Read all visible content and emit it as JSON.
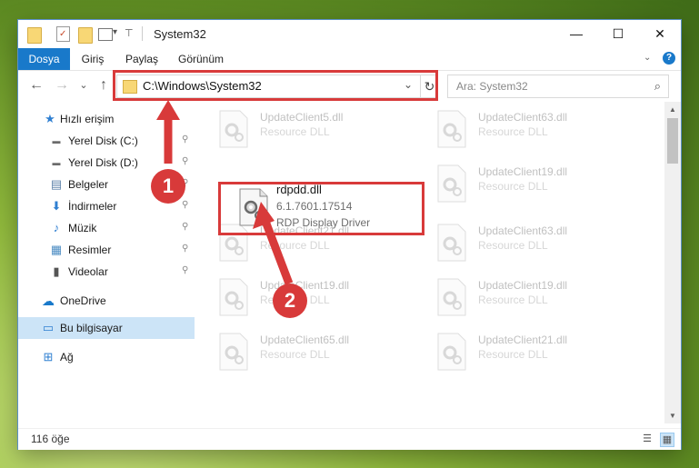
{
  "window": {
    "title": "System32",
    "controls": {
      "minimize": "—",
      "maximize": "☐",
      "close": "✕"
    }
  },
  "ribbon": {
    "tabs": [
      {
        "label": "Dosya",
        "active": true
      },
      {
        "label": "Giriş",
        "active": false
      },
      {
        "label": "Paylaş",
        "active": false
      },
      {
        "label": "Görünüm",
        "active": false
      }
    ]
  },
  "nav": {
    "back": "←",
    "forward": "→",
    "recent": "⌄",
    "up": "↑",
    "address": "C:\\Windows\\System32",
    "address_dropdown": "⌄",
    "refresh": "↻",
    "search_placeholder": "Ara: System32",
    "search_icon": "⌕"
  },
  "sidebar": {
    "items": [
      {
        "label": "Hızlı erişim",
        "icon": "★",
        "icon_name": "star-icon"
      },
      {
        "label": "Yerel Disk (C:)",
        "icon": "▬",
        "icon_name": "drive-icon"
      },
      {
        "label": "Yerel Disk (D:)",
        "icon": "▬",
        "icon_name": "drive-icon"
      },
      {
        "label": "Belgeler",
        "icon": "▤",
        "icon_name": "documents-icon"
      },
      {
        "label": "İndirmeler",
        "icon": "⬇",
        "icon_name": "downloads-icon"
      },
      {
        "label": "Müzik",
        "icon": "♪",
        "icon_name": "music-icon"
      },
      {
        "label": "Resimler",
        "icon": "▦",
        "icon_name": "pictures-icon"
      },
      {
        "label": "Videolar",
        "icon": "▮",
        "icon_name": "videos-icon"
      },
      {
        "label": "OneDrive",
        "icon": "☁",
        "icon_name": "cloud-icon"
      },
      {
        "label": "Bu bilgisayar",
        "icon": "▭",
        "icon_name": "computer-icon"
      },
      {
        "label": "Ağ",
        "icon": "⊞",
        "icon_name": "network-icon"
      }
    ],
    "pin": "⚲"
  },
  "files": {
    "featured": {
      "name": "rdpdd.dll",
      "version": "6.1.7601.17514",
      "description": "RDP Display Driver"
    },
    "faded": [
      {
        "name": "UpdateClient5.dll",
        "desc": "Resource DLL"
      },
      {
        "name": "UpdateClient63.dll",
        "desc": "Resource DLL"
      },
      {
        "name": "UpdateClient19.dll",
        "desc": "Resource DLL"
      },
      {
        "name": "UpdateClient21.dll",
        "desc": "Resource DLL"
      },
      {
        "name": "UpdateClient63.dll",
        "desc": "Resource DLL"
      },
      {
        "name": "UpdateClient19.dll",
        "desc": "Resource DLL"
      },
      {
        "name": "UpdateClient19.dll",
        "desc": "Resource DLL"
      },
      {
        "name": "UpdateClient65.dll",
        "desc": "Resource DLL"
      },
      {
        "name": "UpdateClient21.dll",
        "desc": "Resource DLL"
      }
    ]
  },
  "status": {
    "item_count": "116 öğe",
    "view_details": "☰",
    "view_icons": "▦"
  },
  "annotations": {
    "callout_1": "1",
    "callout_2": "2"
  },
  "colors": {
    "accent": "#1979ca",
    "highlight": "#d83a3a",
    "selection": "#cce4f7"
  }
}
